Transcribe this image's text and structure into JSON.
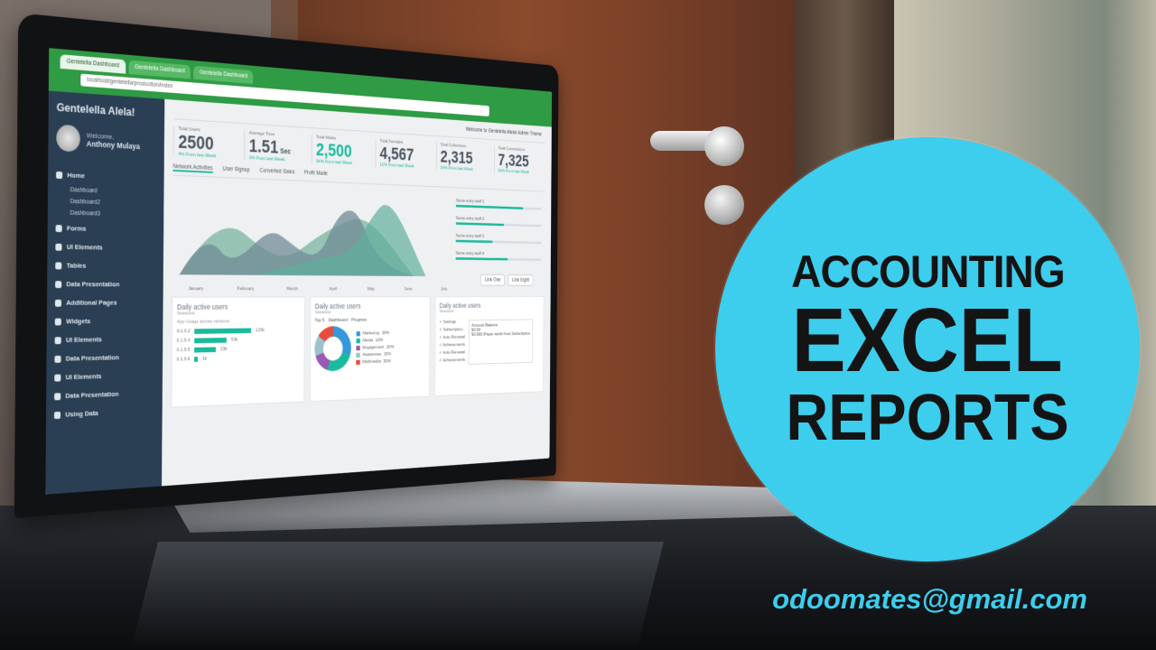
{
  "overlay": {
    "line1": "ACCOUNTING",
    "line2": "EXCEL",
    "line3": "REPORTS",
    "email": "odoomates@gmail.com",
    "badge_color": "#3dcded"
  },
  "dashboard": {
    "browser": {
      "tabs": [
        "Gentelella Dashboard",
        "Gentelella Dashboard",
        "Gentelella Dashboard"
      ],
      "address": "localhost/gentelella/production/index",
      "welcome": "Welcome to Gentelella Alela! Admin Theme"
    },
    "brand": "Gentelella Alela!",
    "profile": {
      "welcome": "Welcome,",
      "name": "Anthony Mulaya"
    },
    "nav": [
      {
        "label": "Home",
        "icon": "home-icon"
      },
      {
        "label": "Dashboard",
        "sub": true
      },
      {
        "label": "Dashboard2",
        "sub": true
      },
      {
        "label": "Dashboard3",
        "sub": true
      },
      {
        "label": "Forms",
        "icon": "edit-icon"
      },
      {
        "label": "UI Elements",
        "icon": "desktop-icon"
      },
      {
        "label": "Tables",
        "icon": "table-icon"
      },
      {
        "label": "Data Presentation",
        "icon": "chart-icon"
      },
      {
        "label": "Additional Pages",
        "icon": "clone-icon"
      },
      {
        "label": "Widgets",
        "icon": "widget-icon"
      },
      {
        "label": "UI Elements",
        "icon": "desktop-icon"
      },
      {
        "label": "Data Presentation",
        "icon": "chart-icon"
      },
      {
        "label": "UI Elements",
        "icon": "desktop-icon"
      },
      {
        "label": "Data Presentation",
        "icon": "chart-icon"
      },
      {
        "label": "Using Data",
        "icon": "bug-icon"
      }
    ],
    "stats": [
      {
        "label": "Total Users",
        "value": "2500",
        "unit": "",
        "sub": "4% From last Week",
        "green": false
      },
      {
        "label": "Average Time",
        "value": "1.51",
        "unit": "Sec",
        "sub": "3% From last Week",
        "green": false
      },
      {
        "label": "Total Males",
        "value": "2,500",
        "unit": "",
        "sub": "34% From last Week",
        "green": true
      },
      {
        "label": "Total Females",
        "value": "4,567",
        "unit": "",
        "sub": "12% From last Week",
        "green": false
      },
      {
        "label": "Total Collections",
        "value": "2,315",
        "unit": "",
        "sub": "34% From last Week",
        "green": false
      },
      {
        "label": "Total Connections",
        "value": "7,325",
        "unit": "",
        "sub": "34% From last Week",
        "green": false
      }
    ],
    "sub_tabs": [
      "Network Activities",
      "User Signup",
      "Converted Sales",
      "Profit Made"
    ],
    "months": [
      "January",
      "February",
      "March",
      "April",
      "May",
      "June",
      "July"
    ],
    "legend": [
      {
        "label": "Some entry stuff 1",
        "pct": 0.78
      },
      {
        "label": "Some entry stuff 2",
        "pct": 0.55
      },
      {
        "label": "Some entry stuff 3",
        "pct": 0.42
      },
      {
        "label": "Some entry stuff 4",
        "pct": 0.6
      }
    ],
    "line_buttons": [
      "Link One",
      "Link Eight"
    ],
    "panel1": {
      "title": "Daily active users",
      "sub": "Sessions",
      "heading": "App Usage across versions",
      "rows": [
        {
          "label": "0.1.5.2",
          "value": "123k",
          "pct": 0.8
        },
        {
          "label": "0.1.5.4",
          "value": "53k",
          "pct": 0.45
        },
        {
          "label": "0.1.5.5",
          "value": "23k",
          "pct": 0.3
        },
        {
          "label": "0.1.5.6",
          "value": "3k",
          "pct": 0.05
        }
      ]
    },
    "panel2": {
      "title": "Daily active users",
      "sub": "Sessions",
      "top": "Top 5",
      "device": "Dashboard",
      "progress": "Progress",
      "items": [
        {
          "label": "Marketing",
          "pct": "30%",
          "color": "#3498db"
        },
        {
          "label": "Media",
          "pct": "10%",
          "color": "#1abb9c"
        },
        {
          "label": "Engagement",
          "pct": "20%",
          "color": "#9b59b6"
        },
        {
          "label": "Awareness",
          "pct": "15%",
          "color": "#9cc2cb"
        },
        {
          "label": "Multimedia",
          "pct": "30%",
          "color": "#e74c3c"
        }
      ]
    },
    "panel3": {
      "title": "Daily active users",
      "sub": "Sessions",
      "checks": [
        "Settings",
        "Subscription",
        "Auto Renewal",
        "Achievements",
        "Auto Renewal",
        "Achievements"
      ],
      "balance_title": "Account Balance",
      "balance_value": "$0.00",
      "balance_note": "$0,000 (Paper worth Next Subscription"
    }
  }
}
